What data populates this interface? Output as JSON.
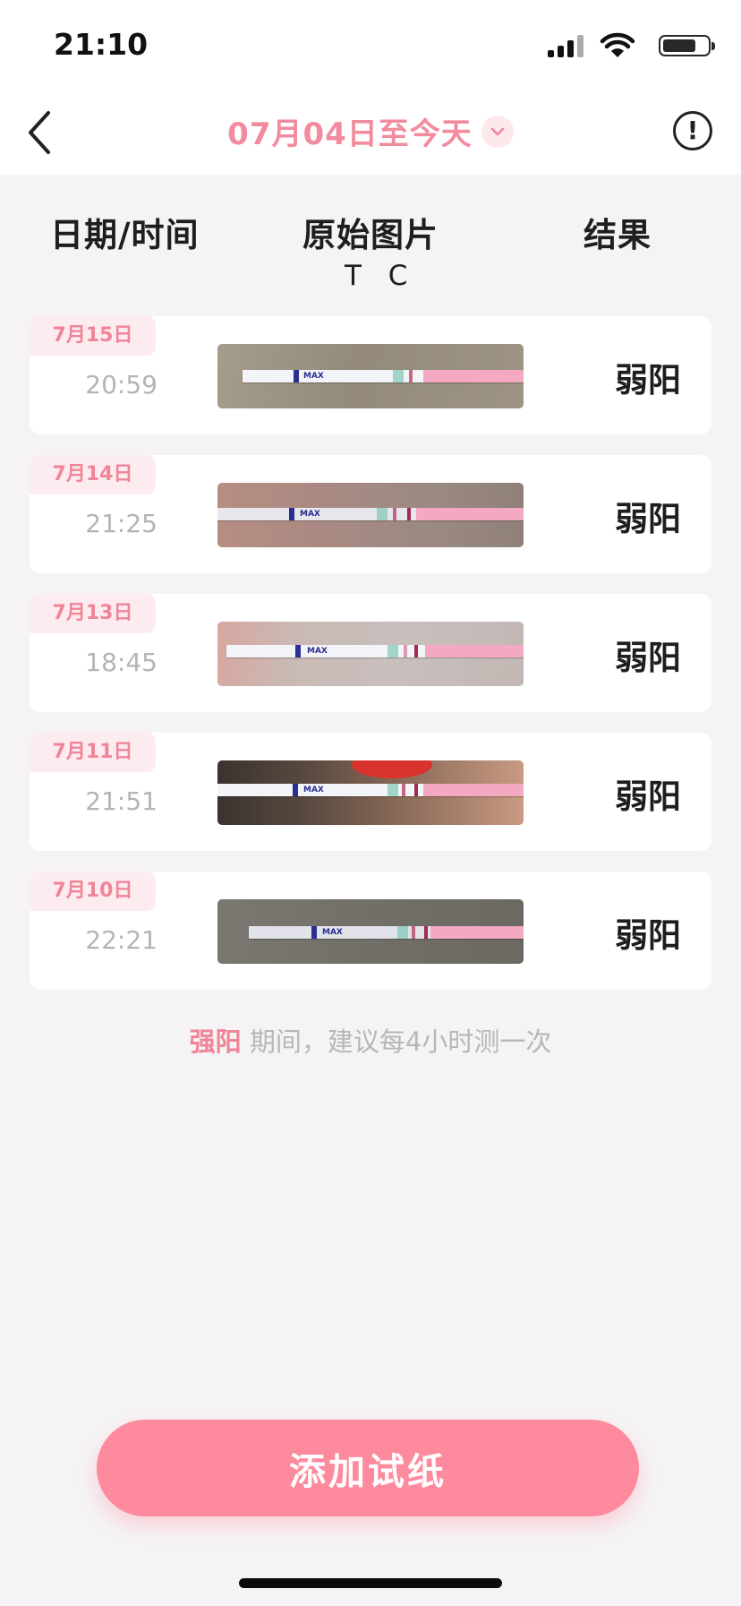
{
  "status_bar": {
    "time": "21:10",
    "battery_level": 0.7
  },
  "header": {
    "title": "07月04日至今天",
    "back_icon": "chevron-left-icon",
    "dropdown_icon": "chevron-down-icon",
    "info_icon": "exclamation-circle-icon",
    "info_glyph": "!"
  },
  "columns": {
    "date": "日期/时间",
    "image": "原始图片",
    "image_sub": "T C",
    "result": "结果"
  },
  "records": [
    {
      "date": "7月15日",
      "time": "20:59",
      "result": "弱阳"
    },
    {
      "date": "7月14日",
      "time": "21:25",
      "result": "弱阳"
    },
    {
      "date": "7月13日",
      "time": "18:45",
      "result": "弱阳"
    },
    {
      "date": "7月11日",
      "time": "21:51",
      "result": "弱阳"
    },
    {
      "date": "7月10日",
      "time": "22:21",
      "result": "弱阳"
    }
  ],
  "strip_text": "MAX",
  "tip": {
    "accent": "强阳",
    "rest": " 期间，建议每4小时测一次"
  },
  "add_button": {
    "label": "添加试纸"
  },
  "colors": {
    "accent": "#f08499",
    "button": "#fe8a9e",
    "date_tag_bg": "#fdecef",
    "background": "#f5f3f5"
  }
}
